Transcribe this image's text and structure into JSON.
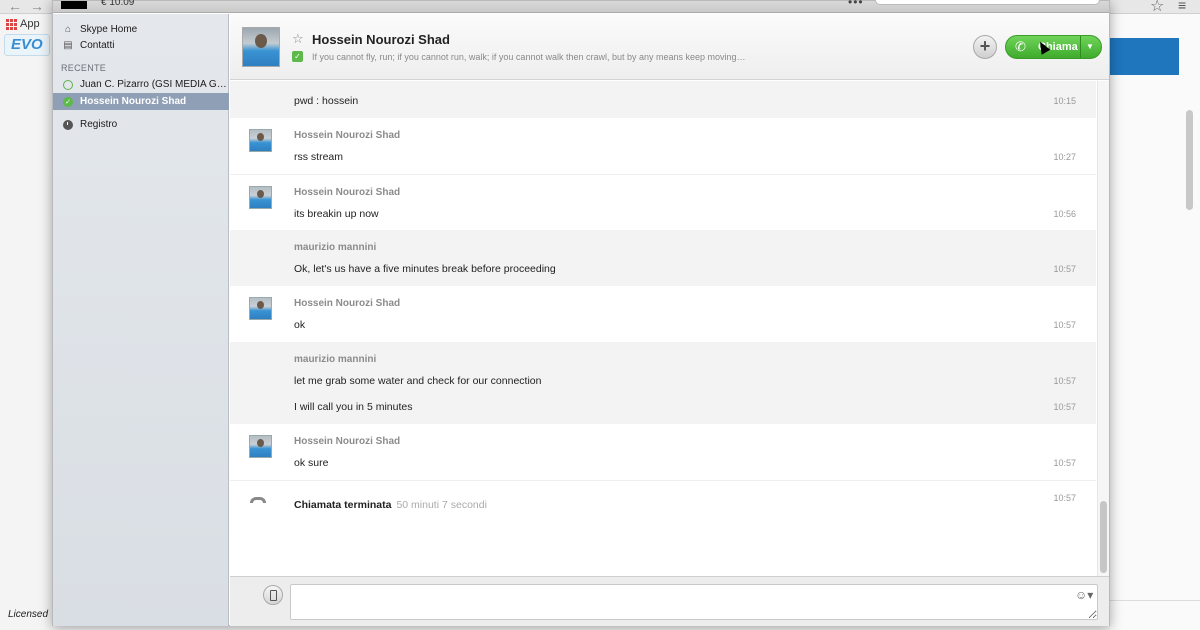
{
  "browser": {
    "apps_label": "App",
    "evo_logo": "EVO",
    "licensed_text": "Licensed"
  },
  "window": {
    "credit": "€ 10.09"
  },
  "sidebar": {
    "items": [
      {
        "label": "Skype Home",
        "icon": "home-icon"
      },
      {
        "label": "Contatti",
        "icon": "contacts-icon"
      }
    ],
    "recent_label": "RECENTE",
    "recent": [
      {
        "label": "Juan C. Pizarro (GSI MEDIA G…",
        "status": "offline"
      },
      {
        "label": "Hossein Nourozi Shad",
        "status": "online",
        "selected": true
      }
    ],
    "history_label": "Registro"
  },
  "header": {
    "contact_name": "Hossein Nourozi Shad",
    "mood": "If you cannot fly, run; if you cannot run, walk; if you cannot walk then crawl, but by any means keep moving…",
    "call_label": "Chiama",
    "call_color": "#4cbf36"
  },
  "messages": [
    {
      "sender": "",
      "lines": [
        {
          "text": "pwd : hossein",
          "time": "10:15"
        }
      ]
    },
    {
      "sender": "Hossein Nourozi Shad",
      "lines": [
        {
          "text": "rss stream",
          "time": "10:27"
        }
      ]
    },
    {
      "sender": "Hossein Nourozi Shad",
      "lines": [
        {
          "text": "its breakin up now",
          "time": "10:56"
        }
      ]
    },
    {
      "sender": "maurizio mannini",
      "lines": [
        {
          "text": "Ok, let's us have a five minutes break before proceeding",
          "time": "10:57"
        }
      ]
    },
    {
      "sender": "Hossein Nourozi Shad",
      "lines": [
        {
          "text": "ok",
          "time": "10:57"
        }
      ]
    },
    {
      "sender": "maurizio mannini",
      "lines": [
        {
          "text": "let me grab some water and check for our connection",
          "time": "10:57"
        },
        {
          "text": "I will call you in 5 minutes",
          "time": "10:57"
        }
      ]
    },
    {
      "sender": "Hossein Nourozi Shad",
      "lines": [
        {
          "text": "ok sure",
          "time": "10:57"
        }
      ]
    }
  ],
  "call_event": {
    "label": "Chiamata terminata",
    "duration": "50 minuti 7 secondi",
    "time": "10:57"
  },
  "input": {
    "value": "",
    "placeholder": ""
  }
}
